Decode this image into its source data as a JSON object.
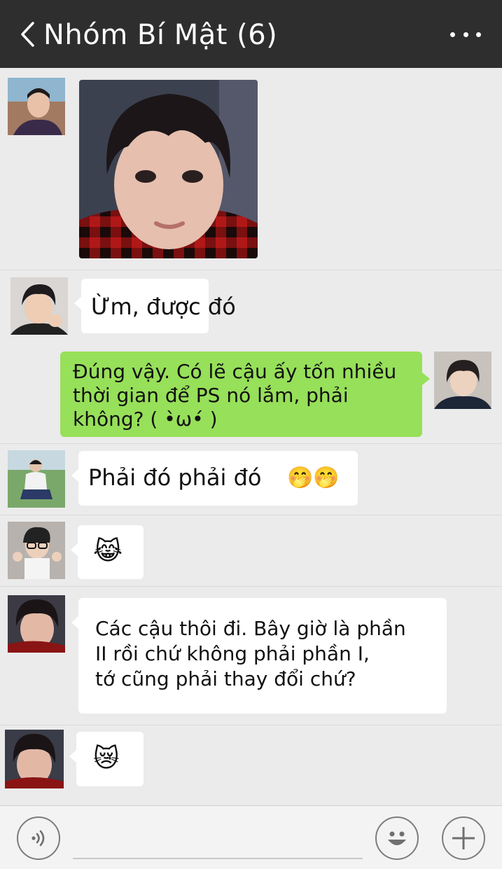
{
  "header": {
    "title": "Nhóm Bí Mật (6)",
    "back_icon": "chevron-left-icon",
    "more_icon": "more-dots-icon"
  },
  "messages": [
    {
      "type": "image",
      "direction": "received",
      "description_icon": "photo-message"
    },
    {
      "type": "text",
      "direction": "received",
      "text": "Ừm, được đó"
    },
    {
      "type": "text",
      "direction": "sent",
      "lines": [
        "Đúng vậy. Có lẽ cậu ấy tốn nhiều",
        "thời gian để PS nó lắm, phải",
        "không? ( •̀ω•́ )"
      ]
    },
    {
      "type": "text",
      "direction": "received",
      "text": "Phải đó phải đó",
      "emoji": "🤭🤭"
    },
    {
      "type": "emoji",
      "direction": "received",
      "emoji": "😹"
    },
    {
      "type": "text",
      "direction": "received",
      "lines": [
        "Các cậu thôi đi. Bây giờ là phần",
        "II rồi chứ không phải phần I,",
        "tớ cũng phải thay đổi chứ?"
      ]
    },
    {
      "type": "emoji",
      "direction": "received",
      "emoji": "😿"
    }
  ],
  "input_bar": {
    "voice_icon": "voice-icon",
    "emoji_icon": "smiley-icon",
    "add_icon": "plus-icon"
  },
  "colors": {
    "header_bg": "#2e2e2e",
    "chat_bg": "#ebebeb",
    "sent_bubble": "#97e05a",
    "received_bubble": "#ffffff"
  }
}
